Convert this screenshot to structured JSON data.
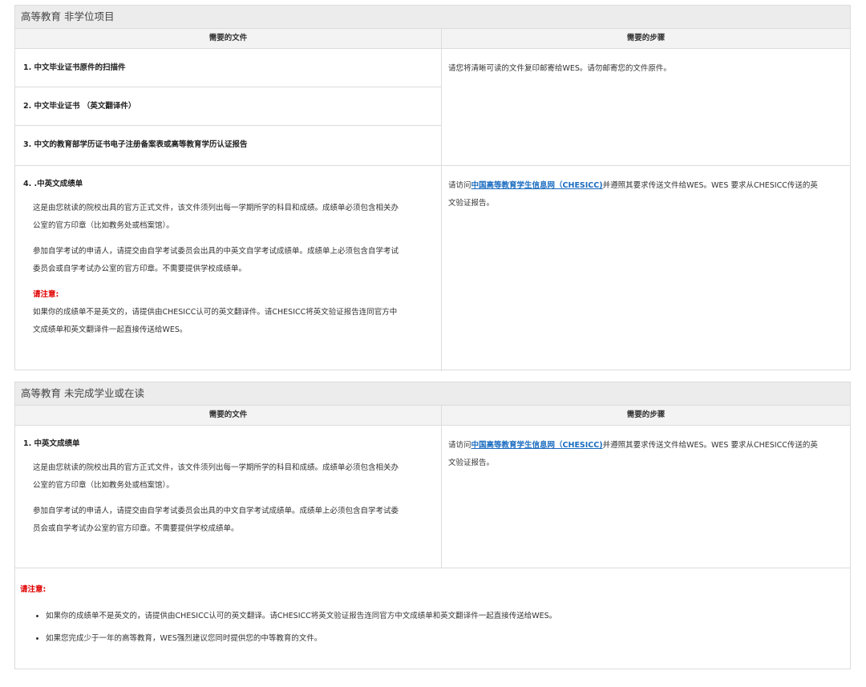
{
  "section1": {
    "title": "高等教育 非学位项目",
    "col_files": "需要的文件",
    "col_steps": "需要的步骤",
    "doc1": "1. 中文毕业证书原件的扫描件",
    "doc2": "2. 中文毕业证书 （英文翻译件）",
    "doc3": "3. 中文的教育部学历证书电子注册备案表或高等教育学历认证报告",
    "step1": "请您将清晰可读的文件复印邮寄给WES。请勿邮寄您的文件原件。",
    "doc4_title": "4. .中英文成绩单",
    "doc4_p1a": "这是由您就读的院校出具的官方正式文件，该文件须列出每一学期所学的科目和成绩。成绩单必须包含相关办",
    "doc4_p1b": "公室的官方印章（比如教务处或档案馆）。",
    "doc4_p2a": "参加自学考试的申请人，请提交由自学考试委员会出具的中英文自学考试成绩单。成绩单上必须包含自学考试",
    "doc4_p2b": "委员会或自学考试办公室的官方印章。不需要提供学校成绩单。",
    "note_label": "请注意:",
    "doc4_note_a": "如果你的成绩单不是英文的，请提供由CHESICC认可的英文翻译件。请CHESICC将英文验证报告连同官方中",
    "doc4_note_b": "文成绩单和英文翻译件一起直接传送给WES。",
    "step2_prefix": "请访问",
    "step2_link": "中国高等教育学生信息网（CHESICC)",
    "step2_suffix_a": "并遵照其要求传送文件给WES。WES 要求从CHESICC传送的英",
    "step2_suffix_b": "文验证报告。"
  },
  "section2": {
    "title": "高等教育 未完成学业或在读",
    "col_files": "需要的文件",
    "col_steps": "需要的步骤",
    "doc1_title": "1. 中英文成绩单",
    "doc1_p1a": "这是由您就读的院校出具的官方正式文件，该文件须列出每一学期所学的科目和成绩。成绩单必须包含相关办",
    "doc1_p1b": "公室的官方印章（比如教务处或档案馆）。",
    "doc1_p2a": "参加自学考试的申请人，请提交由自学考试委员会出具的中文自学考试成绩单。成绩单上必须包含自学考试委",
    "doc1_p2b": "员会或自学考试办公室的官方印章。不需要提供学校成绩单。",
    "step_prefix": "请访问",
    "step_link": "中国高等教育学生信息网（CHESICC)",
    "step_suffix_a": "并遵照其要求传送文件给WES。WES 要求从CHESICC传送的英",
    "step_suffix_b": "文验证报告。",
    "note_label": "请注意:",
    "notes": [
      "如果你的成绩单不是英文的，请提供由CHESICC认可的英文翻译。请CHESICC将英文验证报告连同官方中文成绩单和英文翻译件一起直接传送给WES。",
      "如果您完成少于一年的高等教育，WES强烈建议您同时提供您的中等教育的文件。"
    ]
  }
}
